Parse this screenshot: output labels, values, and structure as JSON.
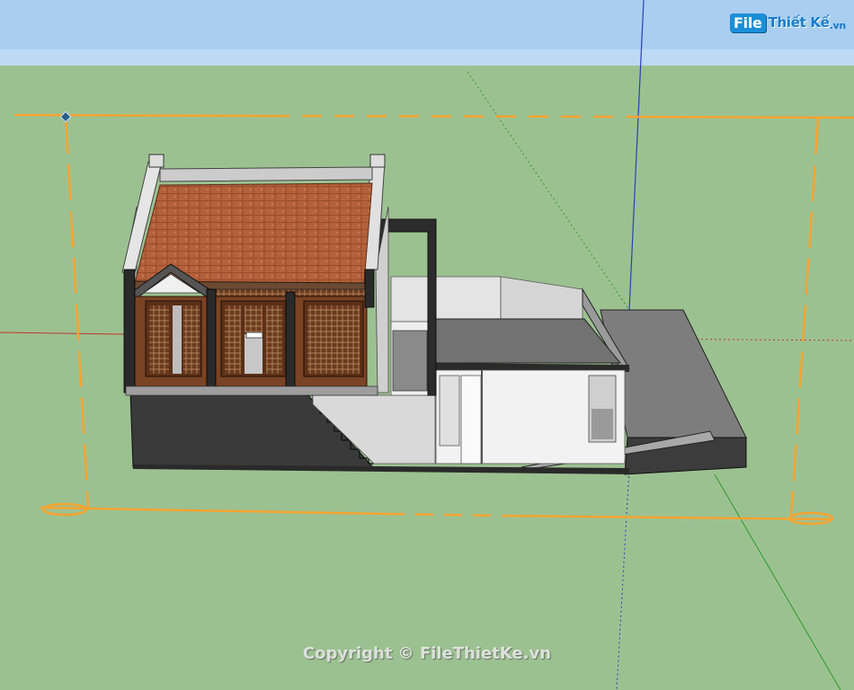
{
  "viewport": {
    "sky_color": "#a9cef0",
    "ground_color": "#9cc191",
    "axis_red": "#c0392b",
    "axis_green": "#2c9c2c",
    "axis_blue": "#2b3fb5",
    "selection_color": "#f5a330"
  },
  "logo": {
    "file_text": "File",
    "rest_text": "Thiết Kế",
    "suffix_text": ".vn"
  },
  "watermark": {
    "text": "Copyright © FileThietKe.vn"
  }
}
